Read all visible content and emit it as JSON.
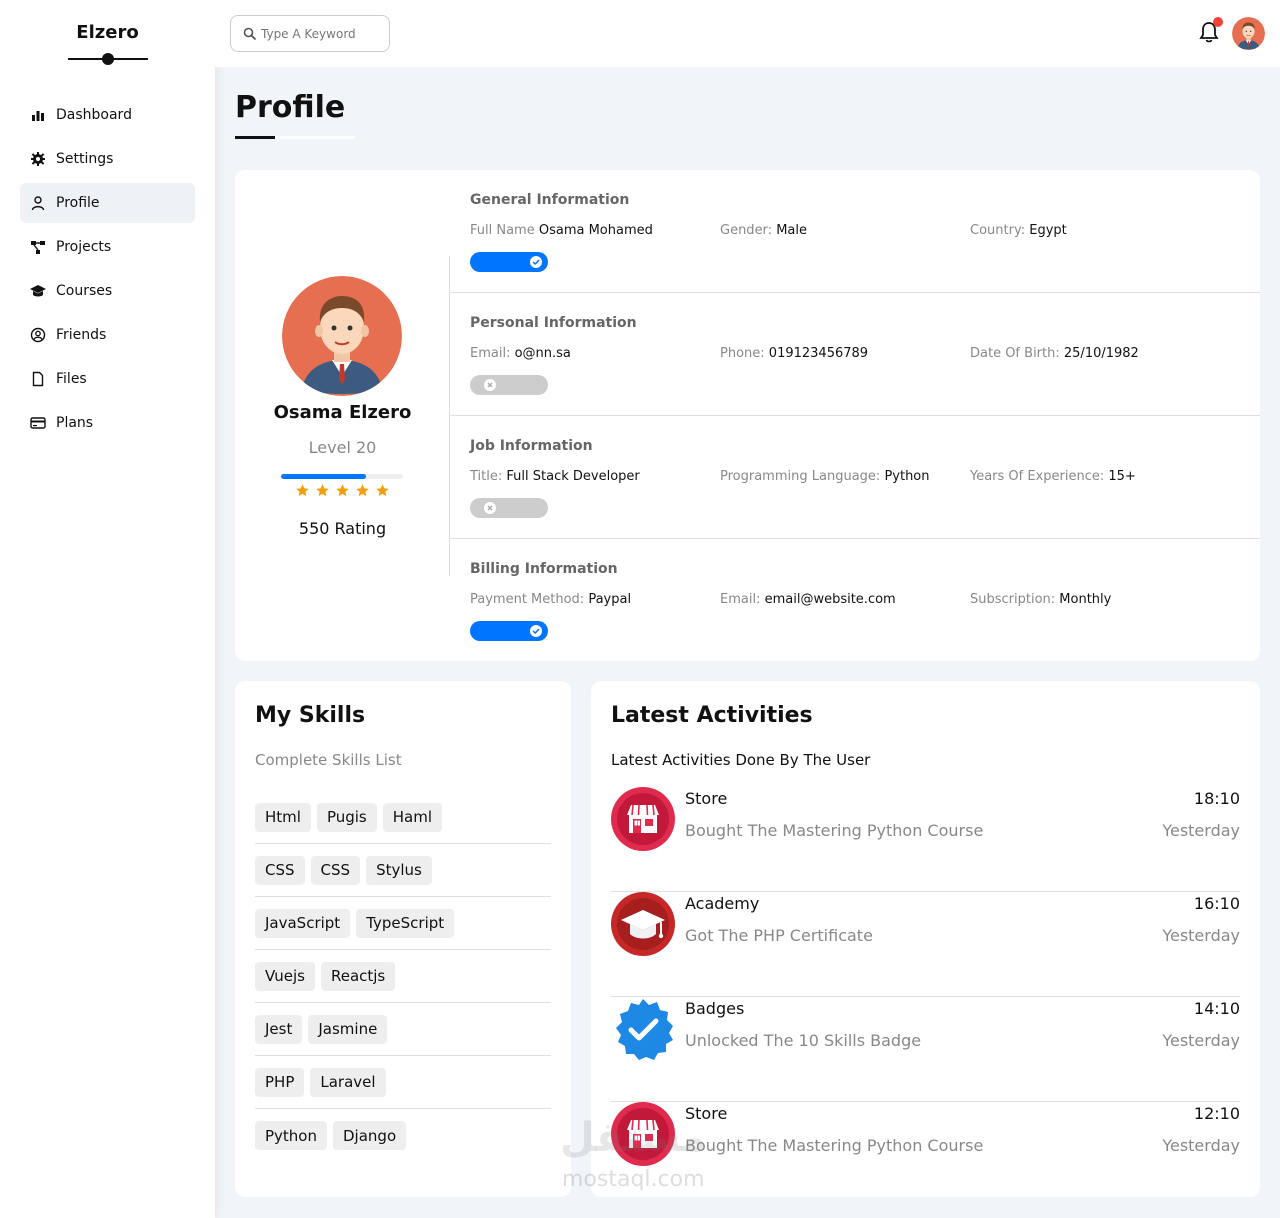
{
  "sidebar": {
    "brand": "Elzero",
    "items": [
      {
        "label": "Dashboard",
        "icon": "chart-bar-icon"
      },
      {
        "label": "Settings",
        "icon": "gear-icon"
      },
      {
        "label": "Profile",
        "icon": "user-icon"
      },
      {
        "label": "Projects",
        "icon": "diagram-icon"
      },
      {
        "label": "Courses",
        "icon": "graduation-cap-icon"
      },
      {
        "label": "Friends",
        "icon": "user-circle-icon"
      },
      {
        "label": "Files",
        "icon": "file-icon"
      },
      {
        "label": "Plans",
        "icon": "credit-card-icon"
      }
    ],
    "active": "Profile"
  },
  "header": {
    "search_placeholder": "Type A Keyword",
    "notification_dot_color": "#f44336"
  },
  "page": {
    "title": "Profile"
  },
  "profile": {
    "name": "Osama Elzero",
    "level": "Level 20",
    "level_progress_percent": 70,
    "stars": 5,
    "rating": "550 Rating",
    "sections": [
      {
        "title": "General Information",
        "items": [
          {
            "label": "Full Name",
            "value": "Osama Mohamed"
          },
          {
            "label": "Gender:",
            "value": "Male"
          },
          {
            "label": "Country:",
            "value": "Egypt"
          }
        ],
        "toggle": true
      },
      {
        "title": "Personal Information",
        "items": [
          {
            "label": "Email:",
            "value": "o@nn.sa"
          },
          {
            "label": "Phone:",
            "value": "019123456789"
          },
          {
            "label": "Date Of Birth:",
            "value": "25/10/1982"
          }
        ],
        "toggle": false
      },
      {
        "title": "Job Information",
        "items": [
          {
            "label": "Title:",
            "value": "Full Stack Developer"
          },
          {
            "label": "Programming Language:",
            "value": "Python"
          },
          {
            "label": "Years Of Experience:",
            "value": "15+"
          }
        ],
        "toggle": false
      },
      {
        "title": "Billing Information",
        "items": [
          {
            "label": "Payment Method:",
            "value": "Paypal"
          },
          {
            "label": "Email:",
            "value": "email@website.com"
          },
          {
            "label": "Subscription:",
            "value": "Monthly"
          }
        ],
        "toggle": true
      }
    ]
  },
  "skills": {
    "title": "My Skills",
    "subtitle": "Complete Skills List",
    "rows": [
      [
        "Html",
        "Pugis",
        "Haml"
      ],
      [
        "CSS",
        "CSS",
        "Stylus"
      ],
      [
        "JavaScript",
        "TypeScript"
      ],
      [
        "Vuejs",
        "Reactjs"
      ],
      [
        "Jest",
        "Jasmine"
      ],
      [
        "PHP",
        "Laravel"
      ],
      [
        "Python",
        "Django"
      ]
    ]
  },
  "activities": {
    "title": "Latest Activities",
    "subtitle": "Latest Activities Done By The User",
    "items": [
      {
        "name": "Store",
        "desc": "Bought The Mastering Python Course",
        "time": "18:10",
        "day": "Yesterday",
        "icon": "store-icon"
      },
      {
        "name": "Academy",
        "desc": "Got The PHP Certificate",
        "time": "16:10",
        "day": "Yesterday",
        "icon": "graduation-cap-icon"
      },
      {
        "name": "Badges",
        "desc": "Unlocked The 10 Skills Badge",
        "time": "14:10",
        "day": "Yesterday",
        "icon": "badge-check-icon"
      },
      {
        "name": "Store",
        "desc": "Bought The Mastering Python Course",
        "time": "12:10",
        "day": "Yesterday",
        "icon": "store-icon"
      }
    ]
  },
  "watermark": {
    "arabic": "مستقل",
    "latin": "mostaql.com"
  },
  "colors": {
    "accent": "#0075ff",
    "toggle_off": "#cccccc",
    "star": "#f59e0b",
    "store_red": "#e02a4e"
  }
}
